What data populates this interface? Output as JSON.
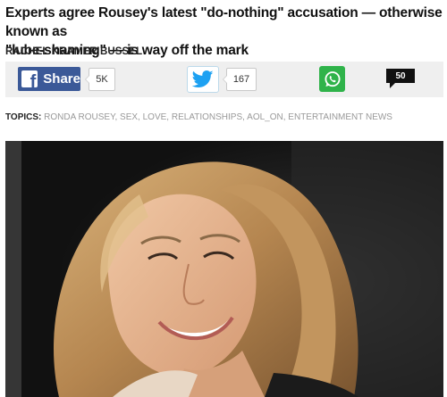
{
  "article": {
    "headline_line1": "Experts agree Rousey's latest \"do-nothing\" accusation — otherwise known as",
    "headline_line2": "\"lube-shaming\" — is way off the mark",
    "author": "RACHEL KRAMER BUSSEL"
  },
  "share_bar": {
    "facebook_label": "Share",
    "facebook_icon_glyph": "f",
    "facebook_count": "5K",
    "twitter_count": "167",
    "comment_count": "50",
    "colors": {
      "facebook": "#3b5998",
      "twitter": "#1da1f2",
      "whatsapp": "#2fb34a",
      "bar_bg": "#efefef"
    },
    "icons": [
      "facebook-icon",
      "twitter-bird-icon",
      "whatsapp-icon",
      "comment-bubble-icon"
    ]
  },
  "topics": {
    "label": "TOPICS:",
    "items": [
      "RONDA ROUSEY",
      "SEX",
      "LOVE",
      "RELATIONSHIPS",
      "AOL_ON",
      "ENTERTAINMENT NEWS"
    ]
  },
  "image": {
    "subject": "photo-of-smiling-woman-with-long-blonde-hair"
  }
}
